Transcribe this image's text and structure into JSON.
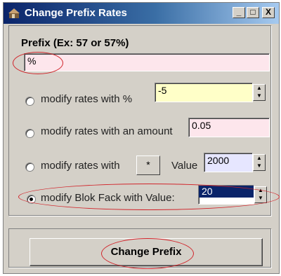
{
  "window": {
    "title": "Change Prefix Rates",
    "controls": {
      "minimize": "_",
      "maximize": "□",
      "close": "X"
    }
  },
  "prefix": {
    "label": "Prefix (Ex: 57 or 57%)",
    "value": "%"
  },
  "options": [
    {
      "label": "modify rates with %",
      "value": "-5",
      "checked": false
    },
    {
      "label": "modify rates with an amount",
      "value": "0.05",
      "checked": false
    },
    {
      "label": "modify rates with",
      "button": "*",
      "value_label": "Value",
      "value": "2000",
      "checked": false
    },
    {
      "label": "modify Blok Fack with Value:",
      "value": "20",
      "checked": true
    }
  ],
  "action": {
    "label": "Change Prefix"
  },
  "colors": {
    "titlebar_start": "#0a246a",
    "titlebar_end": "#a6caf0",
    "window_bg": "#d4d0c8",
    "prefix_field_bg": "#fde6ec",
    "percent_field_bg": "#ffffc8",
    "amount_field_bg": "#fde6ec",
    "value_field_bg": "#e6e6ff",
    "selected_bg": "#0a246a",
    "annotation": "#d1242a"
  },
  "icons": {
    "app": "app-icon",
    "spin_up": "▲",
    "spin_down": "▼"
  }
}
